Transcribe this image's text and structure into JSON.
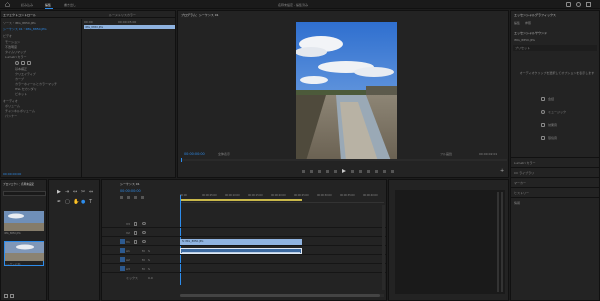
{
  "menubar": {
    "items": [
      "読み込み",
      "編集",
      "書き出し"
    ],
    "active_index": 1,
    "project_title": "名称未設定 - 編集済み"
  },
  "left_panel": {
    "tabs": [
      "エフェクトコントロール",
      "ルーメトリスカラー",
      "ソース（ミックスなし）",
      "オーディオクリップミキサー"
    ],
    "clip_label": "ソース・IMG_8850.JPG",
    "sequence_label": "シーケンス 01・IMG_8850.JPG",
    "timecode_start": "00:00",
    "timecode_mid": "00:00:05:00",
    "clip_bar_label": "IMG_8850.JPG",
    "video_header": "ビデオ",
    "effects": [
      "モーション",
      "不透明度",
      "タイムリマップ",
      "Lumetri カラー",
      "基本補正",
      "クリエイティブ",
      "カーブ",
      "カラーホイールとカラーマッチ",
      "HSL セカンダリ",
      "ビネット"
    ],
    "audio_header": "オーディオ",
    "audio_effects": [
      "ボリューム",
      "チャンネルボリューム",
      "パンナー"
    ],
    "bottom_timecode": "00:00:00:00"
  },
  "program_monitor": {
    "tab": "プログラム：シーケンス 01",
    "timecode": "00:00:00:00",
    "fit": "全体表示",
    "quality": "フル画質",
    "duration": "00:00:02:01"
  },
  "right_panel": {
    "tab": "エッセンシャルグラフィックス",
    "sub_tabs": [
      "編集",
      "参照"
    ],
    "section": "エッセンシャルサウンド",
    "clip_name": "IMG_8850.JPG",
    "preset_label": "プリセット",
    "hint": "オーディオクリップを選択してオプションを表示します",
    "buttons": [
      "会話",
      "ミュージック",
      "効果音",
      "環境音"
    ],
    "bottom_items": [
      "Lumetri カラー",
      "CC ライブラリ",
      "マーカー",
      "ヒストリー",
      "情報"
    ]
  },
  "project_panel": {
    "tabs": [
      "プロジェクト：名称未設定",
      "メディアブラウザー"
    ],
    "search_placeholder": "",
    "items": [
      {
        "name": "IMG_8850.JPG",
        "duration": "5:00"
      },
      {
        "name": "シーケンス 01",
        "duration": "5:00"
      }
    ]
  },
  "timeline": {
    "tab": "シーケンス 01",
    "timecode": "00:00:00:00",
    "ruler": [
      "00:00",
      "00:00:05:00",
      "00:00:10:00",
      "00:00:15:00",
      "00:00:20:00",
      "00:00:25:00",
      "00:00:30:00",
      "00:00:35:00",
      "00:00:40:00"
    ],
    "tracks": [
      "V3",
      "V2",
      "V1",
      "A1",
      "A2",
      "A3"
    ],
    "mix_label": "ミックス",
    "mix_value": "0.0",
    "video_clip_label": "fx IMG_8850.JPG",
    "audio_clip_label": ""
  },
  "colors": {
    "accent": "#2d8ceb",
    "clip_video": "#8fb3e0",
    "clip_audio": "#3d6aa0"
  }
}
